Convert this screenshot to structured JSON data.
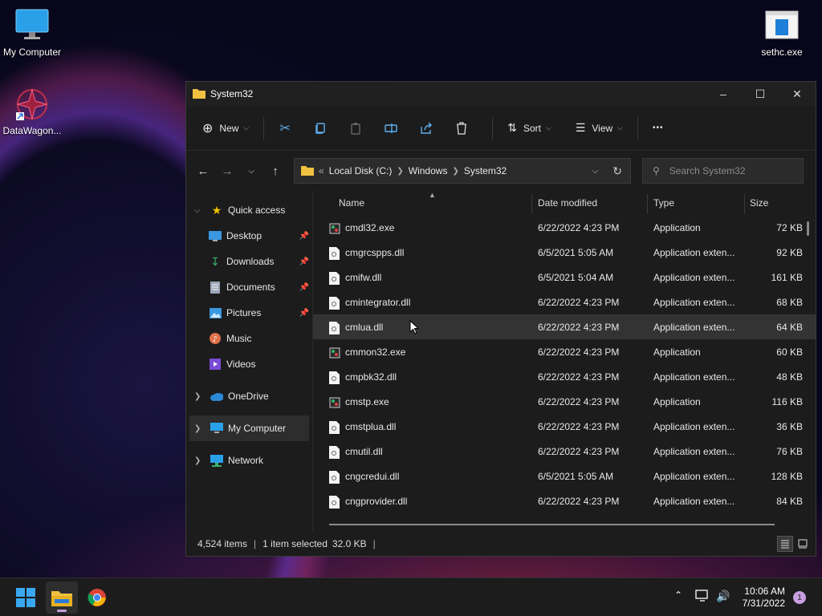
{
  "desktop": {
    "icons": [
      {
        "label": "My Computer"
      },
      {
        "label": "DataWagon..."
      },
      {
        "label": "sethc.exe"
      }
    ]
  },
  "window": {
    "title": "System32",
    "toolbar": {
      "new_label": "New",
      "sort_label": "Sort",
      "view_label": "View",
      "more_label": "•••"
    },
    "address": {
      "crumbs": [
        "Local Disk (C:)",
        "Windows",
        "System32"
      ],
      "overflow": "«"
    },
    "search": {
      "placeholder": "Search System32"
    },
    "nav": {
      "quick_access": "Quick access",
      "items": [
        {
          "label": "Desktop",
          "pinned": true
        },
        {
          "label": "Downloads",
          "pinned": true
        },
        {
          "label": "Documents",
          "pinned": true
        },
        {
          "label": "Pictures",
          "pinned": true
        },
        {
          "label": "Music",
          "pinned": false
        },
        {
          "label": "Videos",
          "pinned": false
        }
      ],
      "onedrive": "OneDrive",
      "my_computer": "My Computer",
      "network": "Network"
    },
    "columns": {
      "name": "Name",
      "date": "Date modified",
      "type": "Type",
      "size": "Size"
    },
    "files": [
      {
        "name": "cmdl32.exe",
        "date": "6/22/2022 4:23 PM",
        "type": "Application",
        "size": "72 KB"
      },
      {
        "name": "cmgrcspps.dll",
        "date": "6/5/2021 5:05 AM",
        "type": "Application exten...",
        "size": "92 KB"
      },
      {
        "name": "cmifw.dll",
        "date": "6/5/2021 5:04 AM",
        "type": "Application exten...",
        "size": "161 KB"
      },
      {
        "name": "cmintegrator.dll",
        "date": "6/22/2022 4:23 PM",
        "type": "Application exten...",
        "size": "68 KB"
      },
      {
        "name": "cmlua.dll",
        "date": "6/22/2022 4:23 PM",
        "type": "Application exten...",
        "size": "64 KB"
      },
      {
        "name": "cmmon32.exe",
        "date": "6/22/2022 4:23 PM",
        "type": "Application",
        "size": "60 KB"
      },
      {
        "name": "cmpbk32.dll",
        "date": "6/22/2022 4:23 PM",
        "type": "Application exten...",
        "size": "48 KB"
      },
      {
        "name": "cmstp.exe",
        "date": "6/22/2022 4:23 PM",
        "type": "Application",
        "size": "116 KB"
      },
      {
        "name": "cmstplua.dll",
        "date": "6/22/2022 4:23 PM",
        "type": "Application exten...",
        "size": "36 KB"
      },
      {
        "name": "cmutil.dll",
        "date": "6/22/2022 4:23 PM",
        "type": "Application exten...",
        "size": "76 KB"
      },
      {
        "name": "cngcredui.dll",
        "date": "6/5/2021 5:05 AM",
        "type": "Application exten...",
        "size": "128 KB"
      },
      {
        "name": "cngprovider.dll",
        "date": "6/22/2022 4:23 PM",
        "type": "Application exten...",
        "size": "84 KB"
      }
    ],
    "status": {
      "items": "4,524 items",
      "selected": "1 item selected",
      "size": "32.0 KB"
    }
  },
  "taskbar": {
    "time": "10:06 AM",
    "date": "7/31/2022",
    "notifications": "1"
  }
}
